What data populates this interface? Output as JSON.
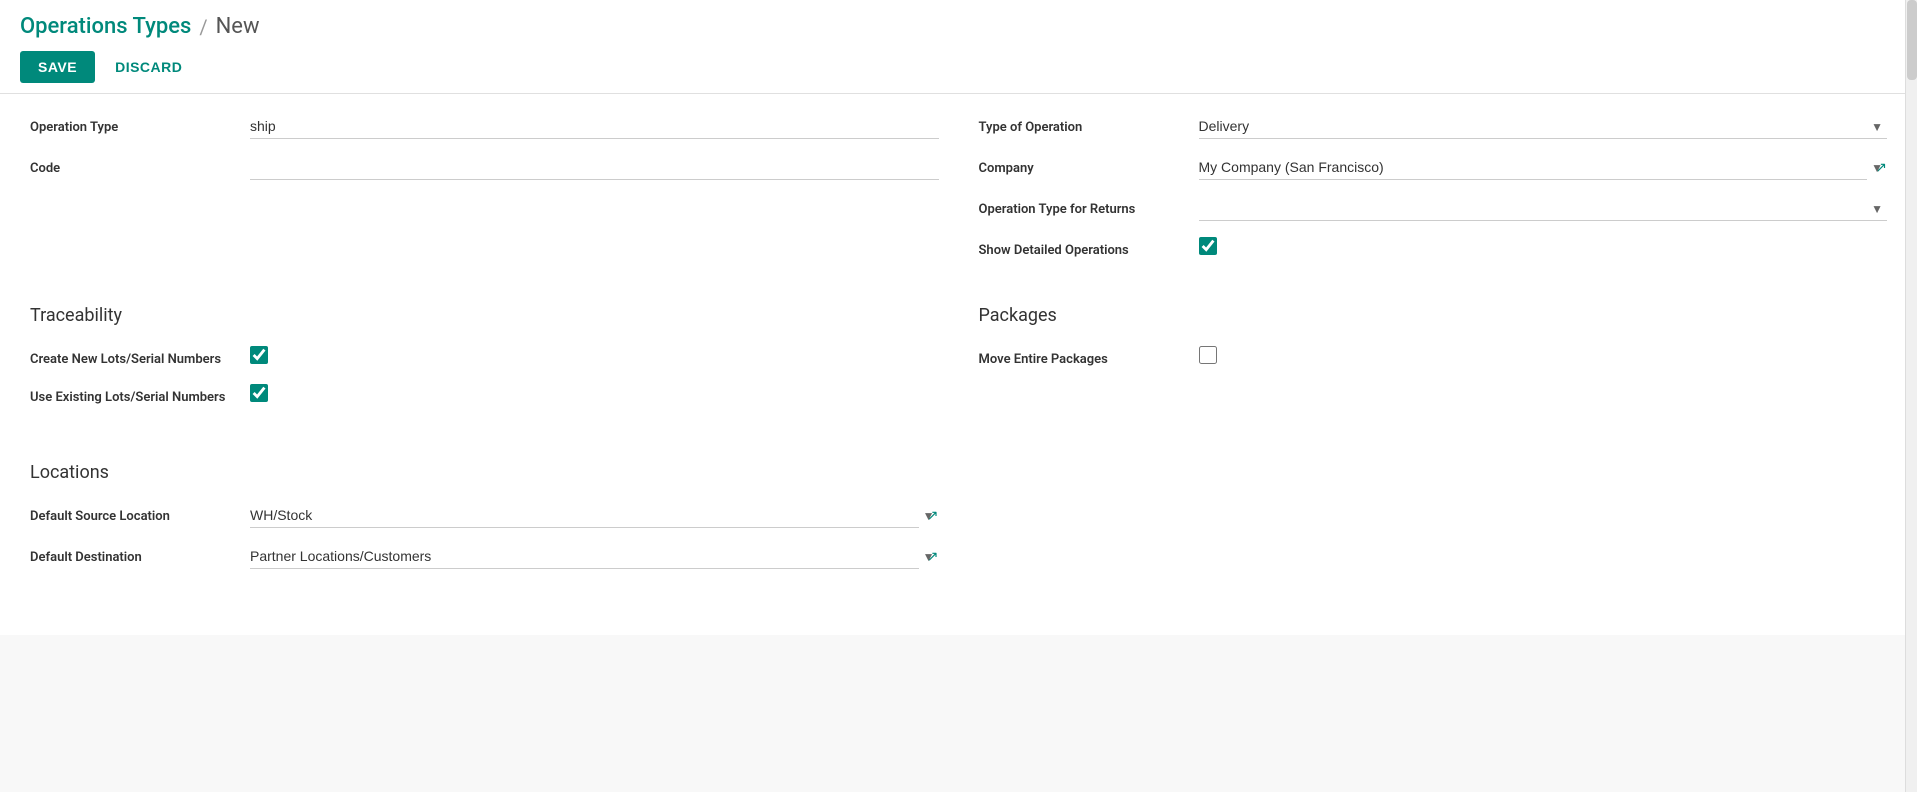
{
  "header": {
    "breadcrumb_link": "Operations Types",
    "breadcrumb_sep": "/",
    "breadcrumb_current": "New",
    "save_label": "SAVE",
    "discard_label": "DISCARD"
  },
  "form": {
    "left": {
      "operation_type_label": "Operation Type",
      "operation_type_value": "ship",
      "code_label": "Code",
      "code_value": ""
    },
    "right": {
      "type_of_operation_label": "Type of Operation",
      "type_of_operation_value": "Delivery",
      "company_label": "Company",
      "company_value": "My Company (San Francisco)",
      "op_type_returns_label": "Operation Type for Returns",
      "op_type_returns_value": "",
      "show_detailed_label": "Show Detailed Operations",
      "show_detailed_checked": true
    }
  },
  "traceability": {
    "title": "Traceability",
    "create_lots_label": "Create New Lots/Serial Numbers",
    "create_lots_checked": true,
    "use_existing_label": "Use Existing Lots/Serial Numbers",
    "use_existing_checked": true
  },
  "packages": {
    "title": "Packages",
    "move_entire_label": "Move Entire Packages",
    "move_entire_checked": false
  },
  "locations": {
    "title": "Locations",
    "default_source_label": "Default Source Location",
    "default_source_value": "WH/Stock",
    "default_dest_label": "Default Destination",
    "default_dest_value": "Partner Locations/Customers"
  }
}
